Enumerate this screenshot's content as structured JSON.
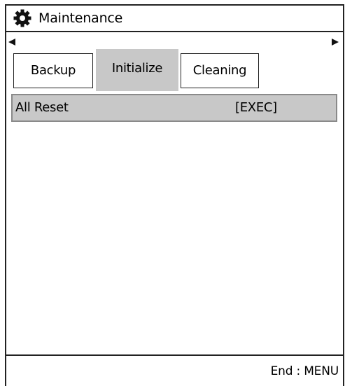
{
  "window": {
    "title": "Maintenance",
    "icon": "gear-icon"
  },
  "tab_nav": {
    "prev_icon": "arrow-left-icon",
    "next_icon": "arrow-right-icon",
    "tabs": [
      {
        "label": "Backup",
        "selected": false
      },
      {
        "label": "Initialize",
        "selected": true
      },
      {
        "label": "Cleaning",
        "selected": false
      }
    ]
  },
  "menu": {
    "items": [
      {
        "label": "All Reset",
        "value": "[EXEC]",
        "highlighted": true
      }
    ]
  },
  "footer": {
    "hint": "End : MENU"
  },
  "colors": {
    "selection": "#c8c8c8",
    "border": "#222222",
    "row_border": "#8a8a8a"
  }
}
